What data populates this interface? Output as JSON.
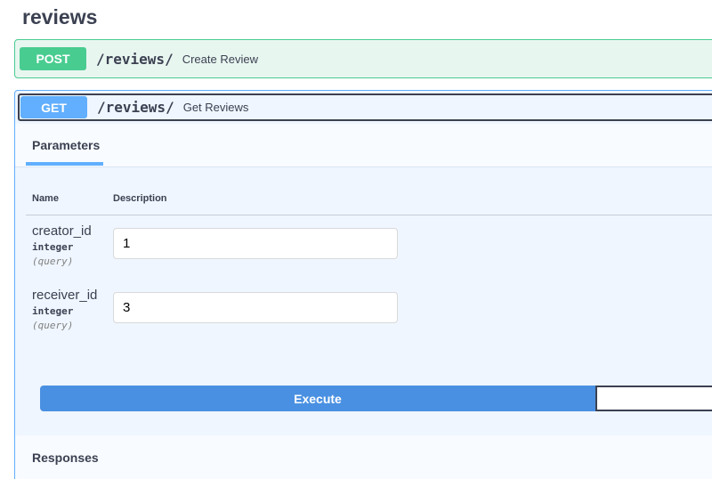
{
  "tag": {
    "title": "reviews"
  },
  "operations": {
    "post": {
      "method": "POST",
      "path": "/reviews/",
      "summary": "Create Review"
    },
    "get": {
      "method": "GET",
      "path": "/reviews/",
      "summary": "Get Reviews"
    }
  },
  "get_details": {
    "parameters_tab": "Parameters",
    "columns": {
      "name": "Name",
      "description": "Description"
    },
    "params": [
      {
        "name": "creator_id",
        "type": "integer",
        "in": "(query)",
        "value": "1"
      },
      {
        "name": "receiver_id",
        "type": "integer",
        "in": "(query)",
        "value": "3"
      }
    ],
    "execute_label": "Execute",
    "responses_title": "Responses"
  },
  "colors": {
    "post": "#49cc90",
    "get": "#61affe",
    "execute": "#4990e2",
    "text": "#3b4151"
  }
}
